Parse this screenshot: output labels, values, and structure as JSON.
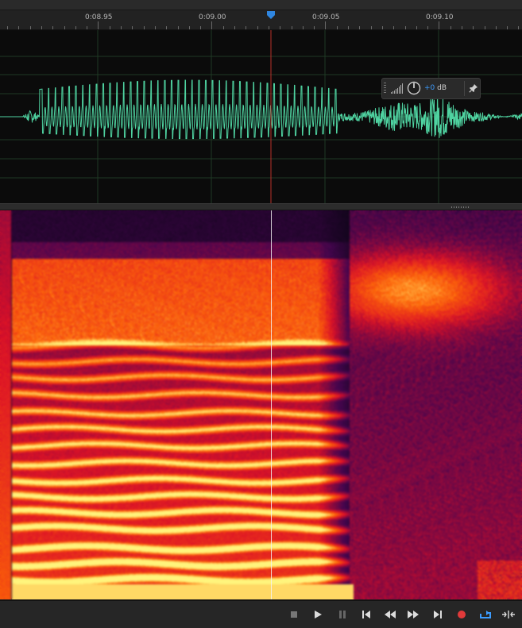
{
  "ruler": {
    "labels": [
      "0:08.95",
      "0:09.00",
      "0:09.05",
      "0:09.10"
    ]
  },
  "hud": {
    "gain_prefix": "+0",
    "gain_unit": "dB"
  },
  "transport": {
    "buttons": [
      "stop",
      "play",
      "pause",
      "go-to-start",
      "rewind",
      "fast-forward",
      "go-to-end",
      "record",
      "loop",
      "skip-selection"
    ]
  },
  "colors": {
    "waveform": "#4fd3a1",
    "playhead_line": "#b8302a",
    "playhead_marker": "#2f86e0",
    "record": "#e03a3a",
    "loop": "#3c9cff"
  }
}
